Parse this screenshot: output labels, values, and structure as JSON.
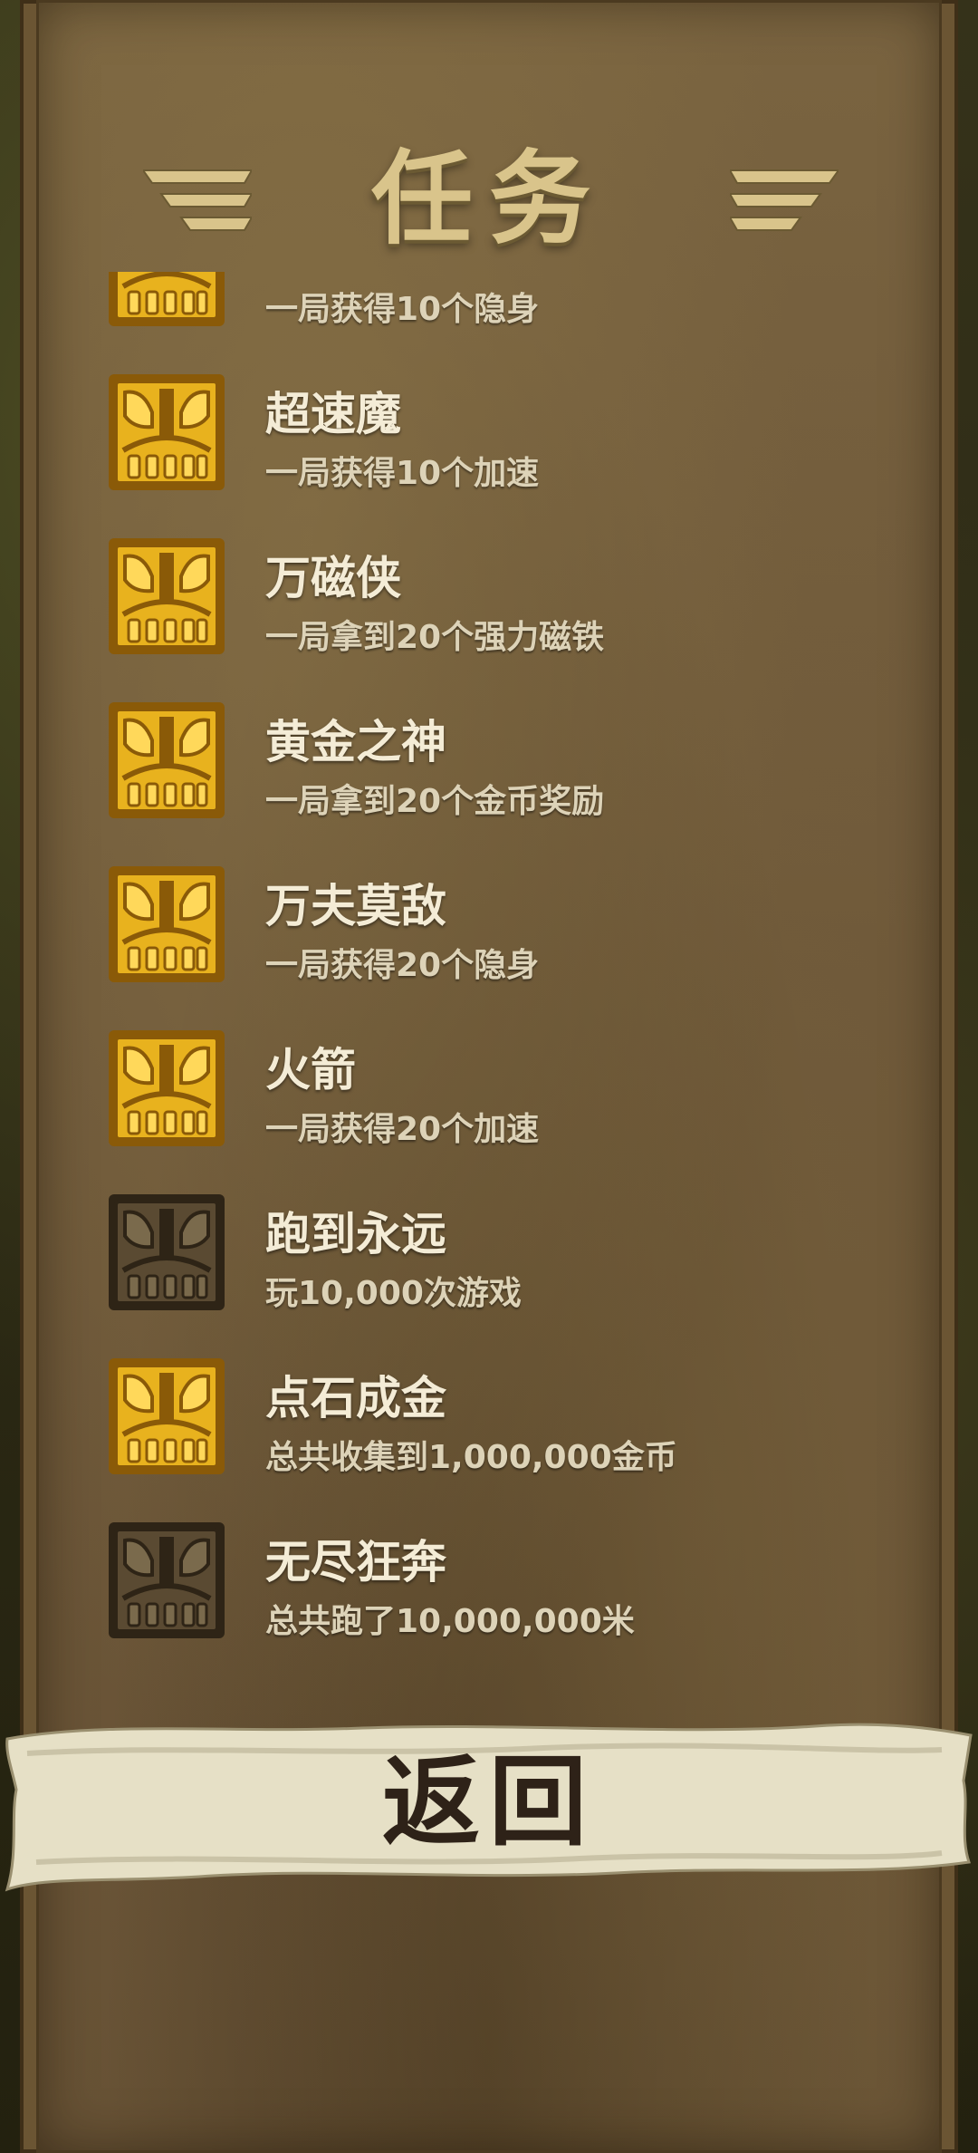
{
  "screen": {
    "title": "任务",
    "back_label": "返回"
  },
  "missions": [
    {
      "title": "",
      "desc": "一局获得10个隐身",
      "completed": true
    },
    {
      "title": "超速魔",
      "desc": "一局获得10个加速",
      "completed": true
    },
    {
      "title": "万磁侠",
      "desc": "一局拿到20个强力磁铁",
      "completed": true
    },
    {
      "title": "黄金之神",
      "desc": "一局拿到20个金币奖励",
      "completed": true
    },
    {
      "title": "万夫莫敌",
      "desc": "一局获得20个隐身",
      "completed": true
    },
    {
      "title": "火箭",
      "desc": "一局获得20个加速",
      "completed": true
    },
    {
      "title": "跑到永远",
      "desc": "玩10,000次游戏",
      "completed": false
    },
    {
      "title": "点石成金",
      "desc": "总共收集到1,000,000金币",
      "completed": true
    },
    {
      "title": "无尽狂奔",
      "desc": "总共跑了10,000,000米",
      "completed": false
    }
  ],
  "colors": {
    "badge_gold": "#e8b21e",
    "badge_gold_dark": "#8a5a08",
    "badge_stone": "#5a4a32",
    "badge_stone_dark": "#2e2416",
    "title_gold": "#d9c48b",
    "scroll_paper": "#e6e0c6"
  }
}
